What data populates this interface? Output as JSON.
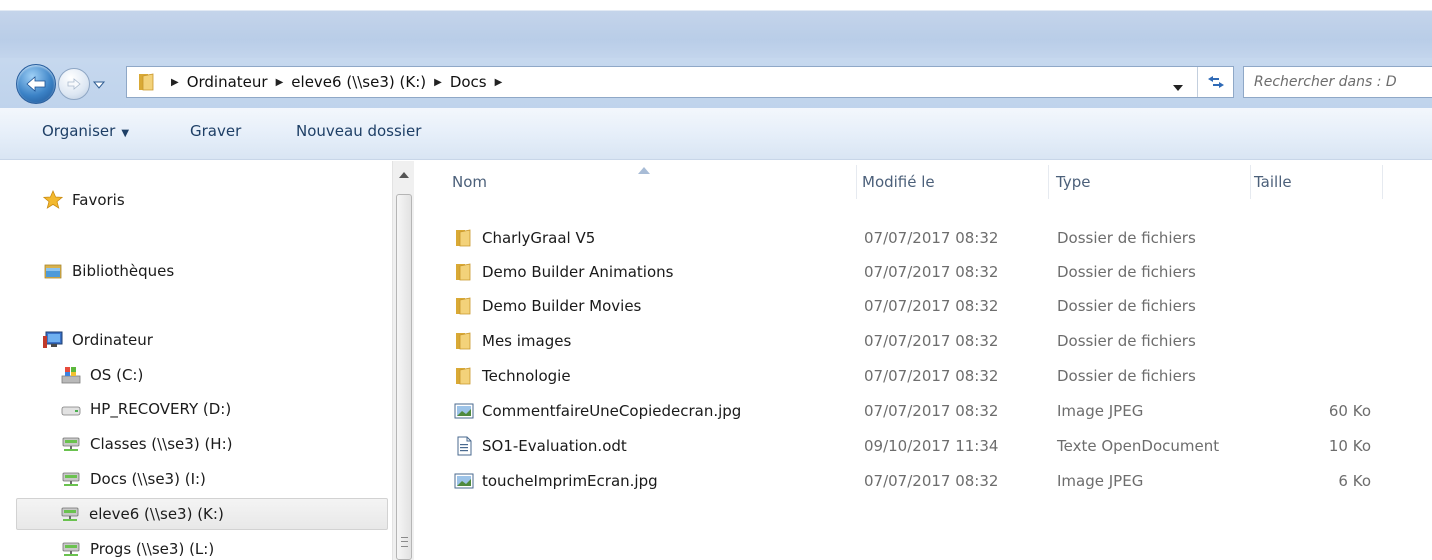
{
  "navigation": {
    "back_icon": "back-arrow-icon",
    "forward_icon": "forward-arrow-icon",
    "breadcrumbs": [
      "Ordinateur",
      "eleve6 (\\\\se3) (K:)",
      "Docs"
    ],
    "search_placeholder": "Rechercher dans : D"
  },
  "toolbar": {
    "organiser": "Organiser",
    "graver": "Graver",
    "nouveau_dossier": "Nouveau dossier"
  },
  "sidebar": {
    "favoris": "Favoris",
    "bibliotheques": "Bibliothèques",
    "ordinateur": "Ordinateur",
    "drives": [
      {
        "label": "OS (C:)",
        "icon": "os-drive-icon"
      },
      {
        "label": "HP_RECOVERY (D:)",
        "icon": "hard-drive-icon"
      },
      {
        "label": "Classes (\\\\se3) (H:)",
        "icon": "network-drive-icon"
      },
      {
        "label": "Docs (\\\\se3) (I:)",
        "icon": "network-drive-icon"
      },
      {
        "label": "eleve6 (\\\\se3) (K:)",
        "icon": "network-drive-icon",
        "selected": true
      },
      {
        "label": "Progs (\\\\se3) (L:)",
        "icon": "network-drive-icon"
      }
    ]
  },
  "columns": {
    "name": "Nom",
    "modified": "Modifié le",
    "type": "Type",
    "size": "Taille"
  },
  "files": [
    {
      "name": "CharlyGraal V5",
      "modified": "07/07/2017 08:32",
      "type": "Dossier de fichiers",
      "size": "",
      "icon": "folder-icon"
    },
    {
      "name": "Demo Builder Animations",
      "modified": "07/07/2017 08:32",
      "type": "Dossier de fichiers",
      "size": "",
      "icon": "folder-icon"
    },
    {
      "name": "Demo Builder Movies",
      "modified": "07/07/2017 08:32",
      "type": "Dossier de fichiers",
      "size": "",
      "icon": "folder-icon"
    },
    {
      "name": "Mes images",
      "modified": "07/07/2017 08:32",
      "type": "Dossier de fichiers",
      "size": "",
      "icon": "folder-icon"
    },
    {
      "name": "Technologie",
      "modified": "07/07/2017 08:32",
      "type": "Dossier de fichiers",
      "size": "",
      "icon": "folder-icon"
    },
    {
      "name": "CommentfaireUneCopiedecran.jpg",
      "modified": "07/07/2017 08:32",
      "type": "Image JPEG",
      "size": "60 Ko",
      "icon": "image-file-icon"
    },
    {
      "name": "SO1-Evaluation.odt",
      "modified": "09/10/2017 11:34",
      "type": "Texte OpenDocument",
      "size": "10 Ko",
      "icon": "document-file-icon"
    },
    {
      "name": "toucheImprimEcran.jpg",
      "modified": "07/07/2017 08:32",
      "type": "Image JPEG",
      "size": "6 Ko",
      "icon": "image-file-icon"
    }
  ],
  "colors": {
    "chrome_blue": "#bfd3ec",
    "toolbar_text": "#1e3f66",
    "header_text": "#4c607a",
    "folder_yellow": "#e8c04a"
  }
}
